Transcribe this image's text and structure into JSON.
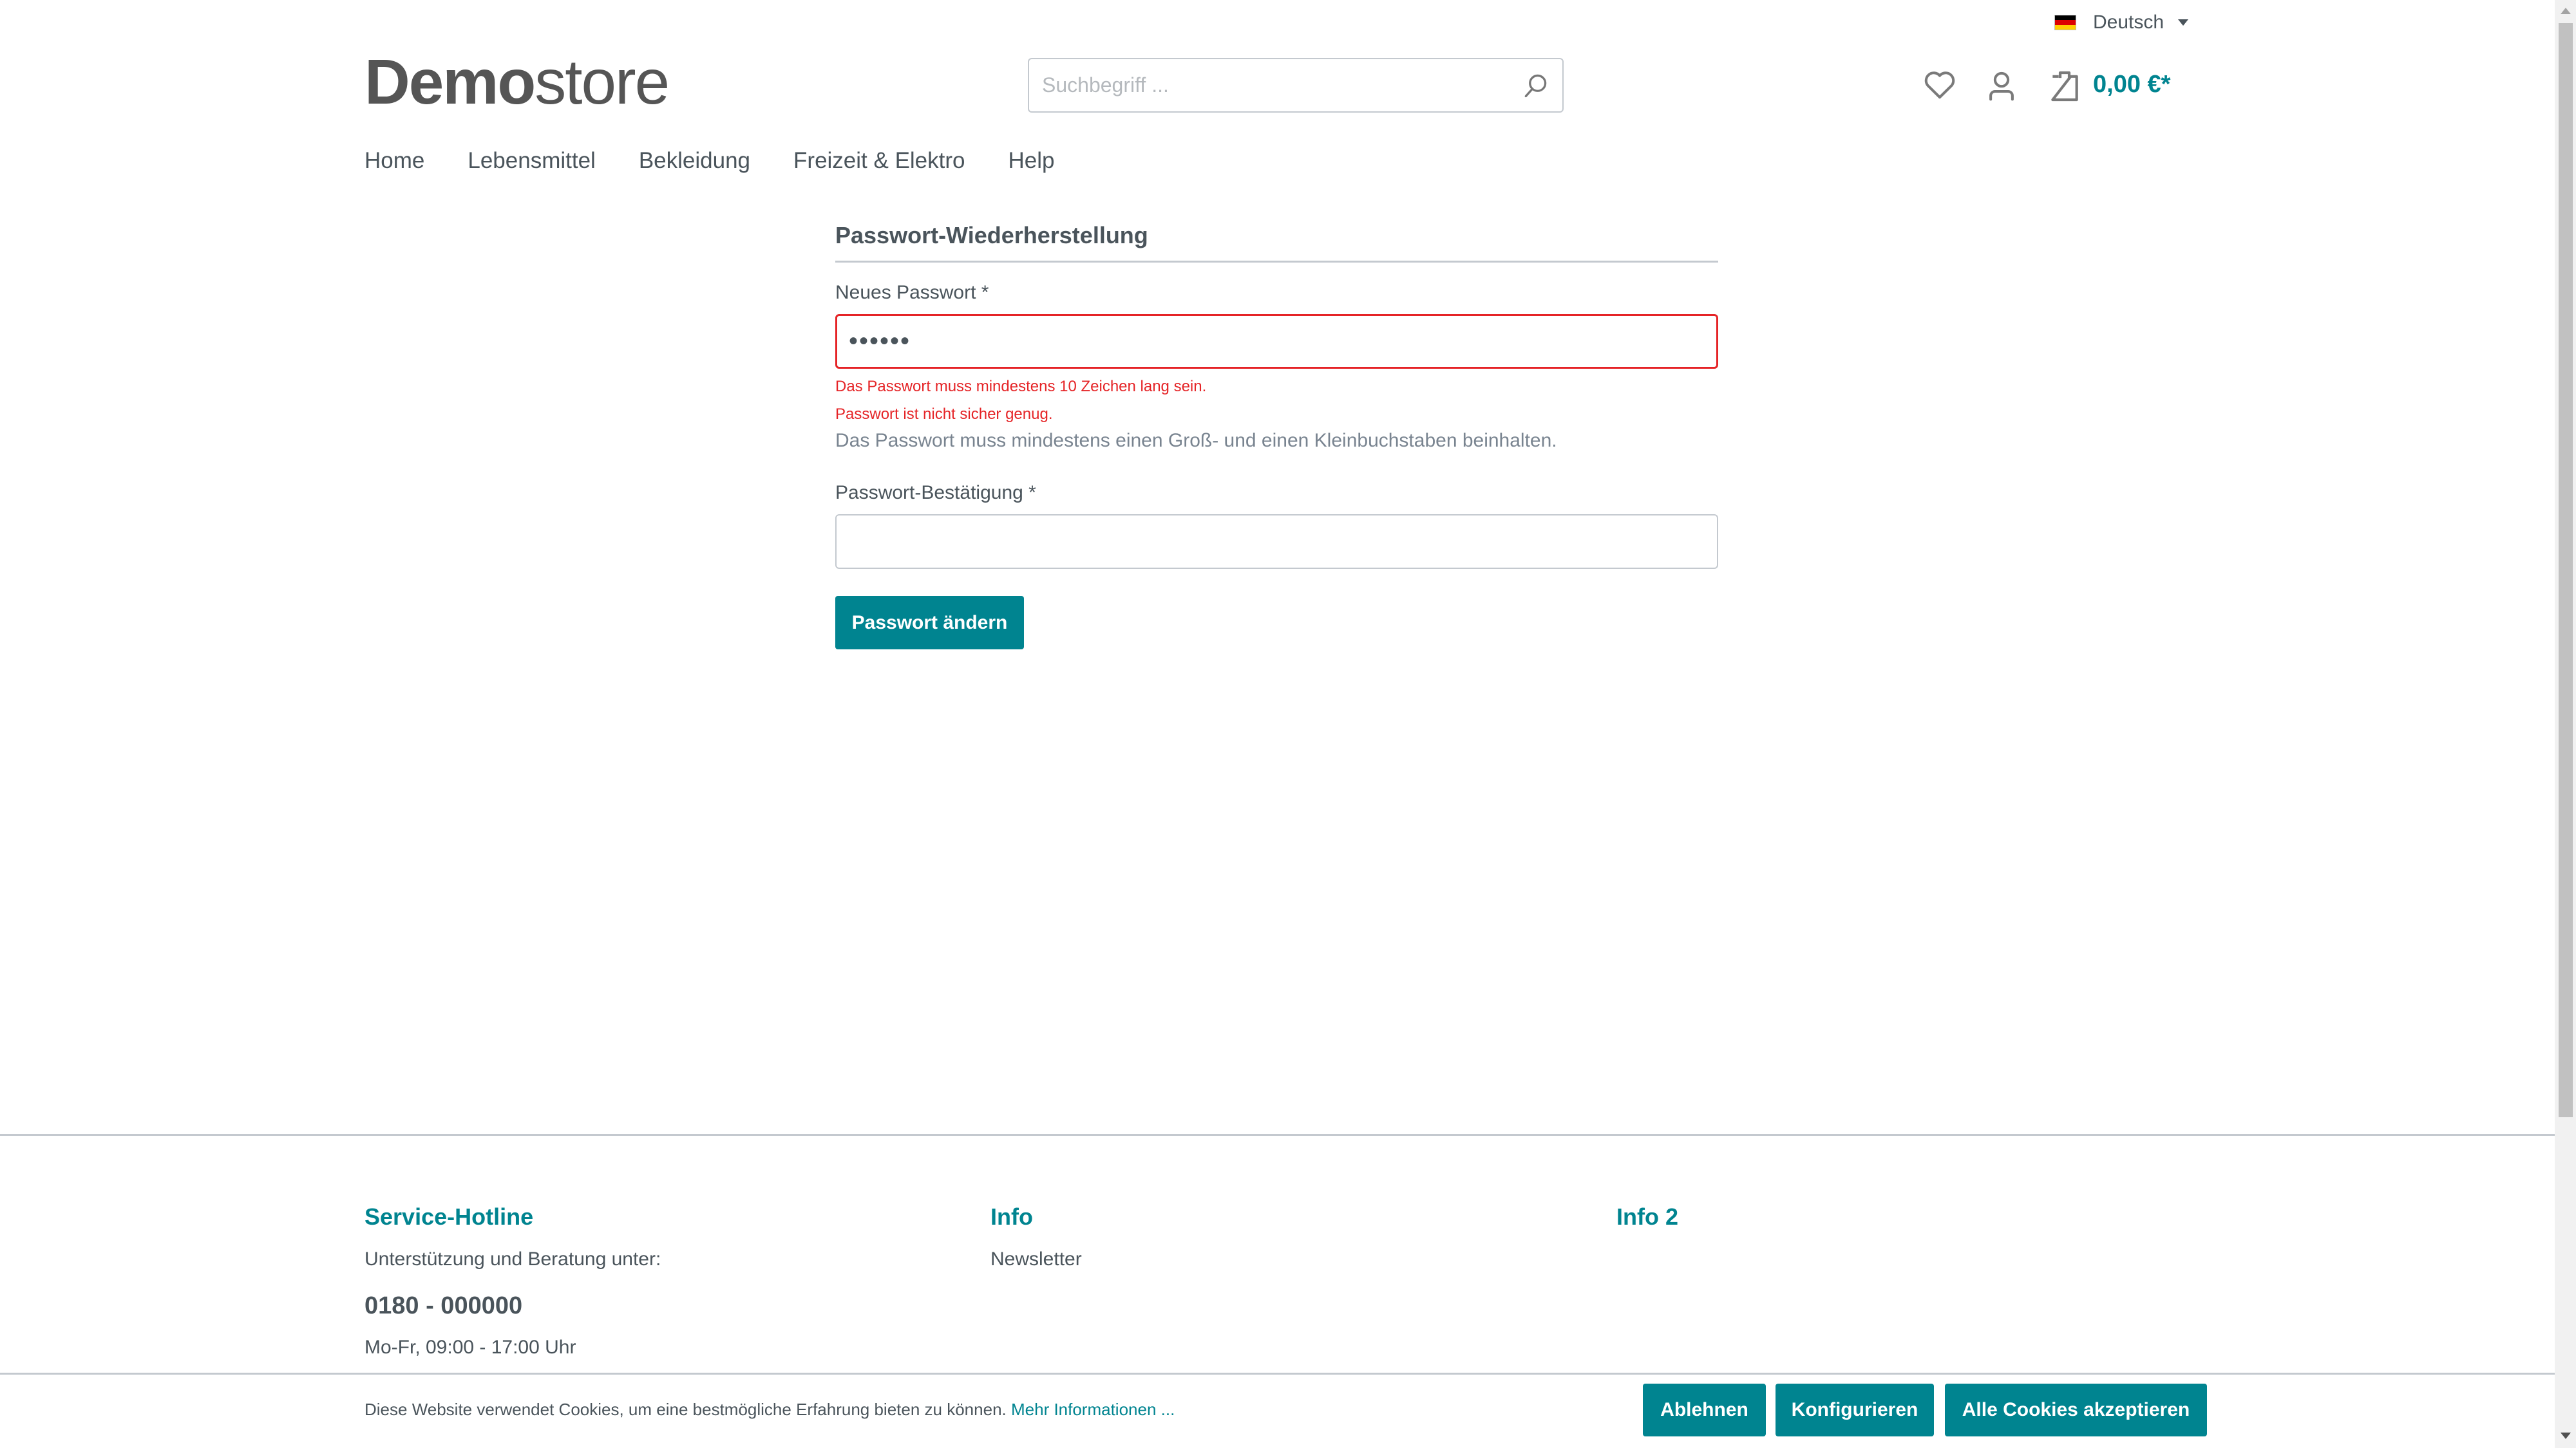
{
  "topbar": {
    "language": "Deutsch",
    "flag_colors": [
      "#000000",
      "#dd0000",
      "#ffce00"
    ]
  },
  "header": {
    "logo_bold": "Demo",
    "logo_light": "store",
    "search_placeholder": "Suchbegriff ...",
    "icons": [
      "heart-icon",
      "user-icon",
      "bag-icon",
      "search-icon"
    ],
    "cart_total": "0,00 €*"
  },
  "nav": {
    "items": [
      "Home",
      "Lebensmittel",
      "Bekleidung",
      "Freizeit & Elektro",
      "Help"
    ]
  },
  "form": {
    "title": "Passwort-Wiederherstellung",
    "new_password_label": "Neues Passwort *",
    "new_password_value": "••••••",
    "errors": [
      "Das Passwort muss mindestens 10 Zeichen lang sein.",
      "Passwort ist nicht sicher genug."
    ],
    "help_text": "Das Passwort muss mindestens einen Groß- und einen Kleinbuchstaben beinhalten.",
    "confirm_label": "Passwort-Bestätigung *",
    "confirm_value": "",
    "submit_label": "Passwort ändern"
  },
  "footer": {
    "hotline": {
      "title": "Service-Hotline",
      "intro": "Unterstützung und Beratung unter:",
      "phone": "0180 - 000000",
      "hours": "Mo-Fr, 09:00 - 17:00 Uhr"
    },
    "info": {
      "title": "Info",
      "links": [
        "Newsletter"
      ]
    },
    "info2": {
      "title": "Info 2"
    }
  },
  "cookie": {
    "text": "Diese Website verwendet Cookies, um eine bestmögliche Erfahrung bieten zu können.",
    "link": "Mehr Informationen ...",
    "decline": "Ablehnen",
    "configure": "Konfigurieren",
    "accept_all": "Alle Cookies akzeptieren"
  },
  "colors": {
    "accent": "#008490",
    "error": "#e52427",
    "text": "#4a545b",
    "border": "#c4c9cf"
  }
}
